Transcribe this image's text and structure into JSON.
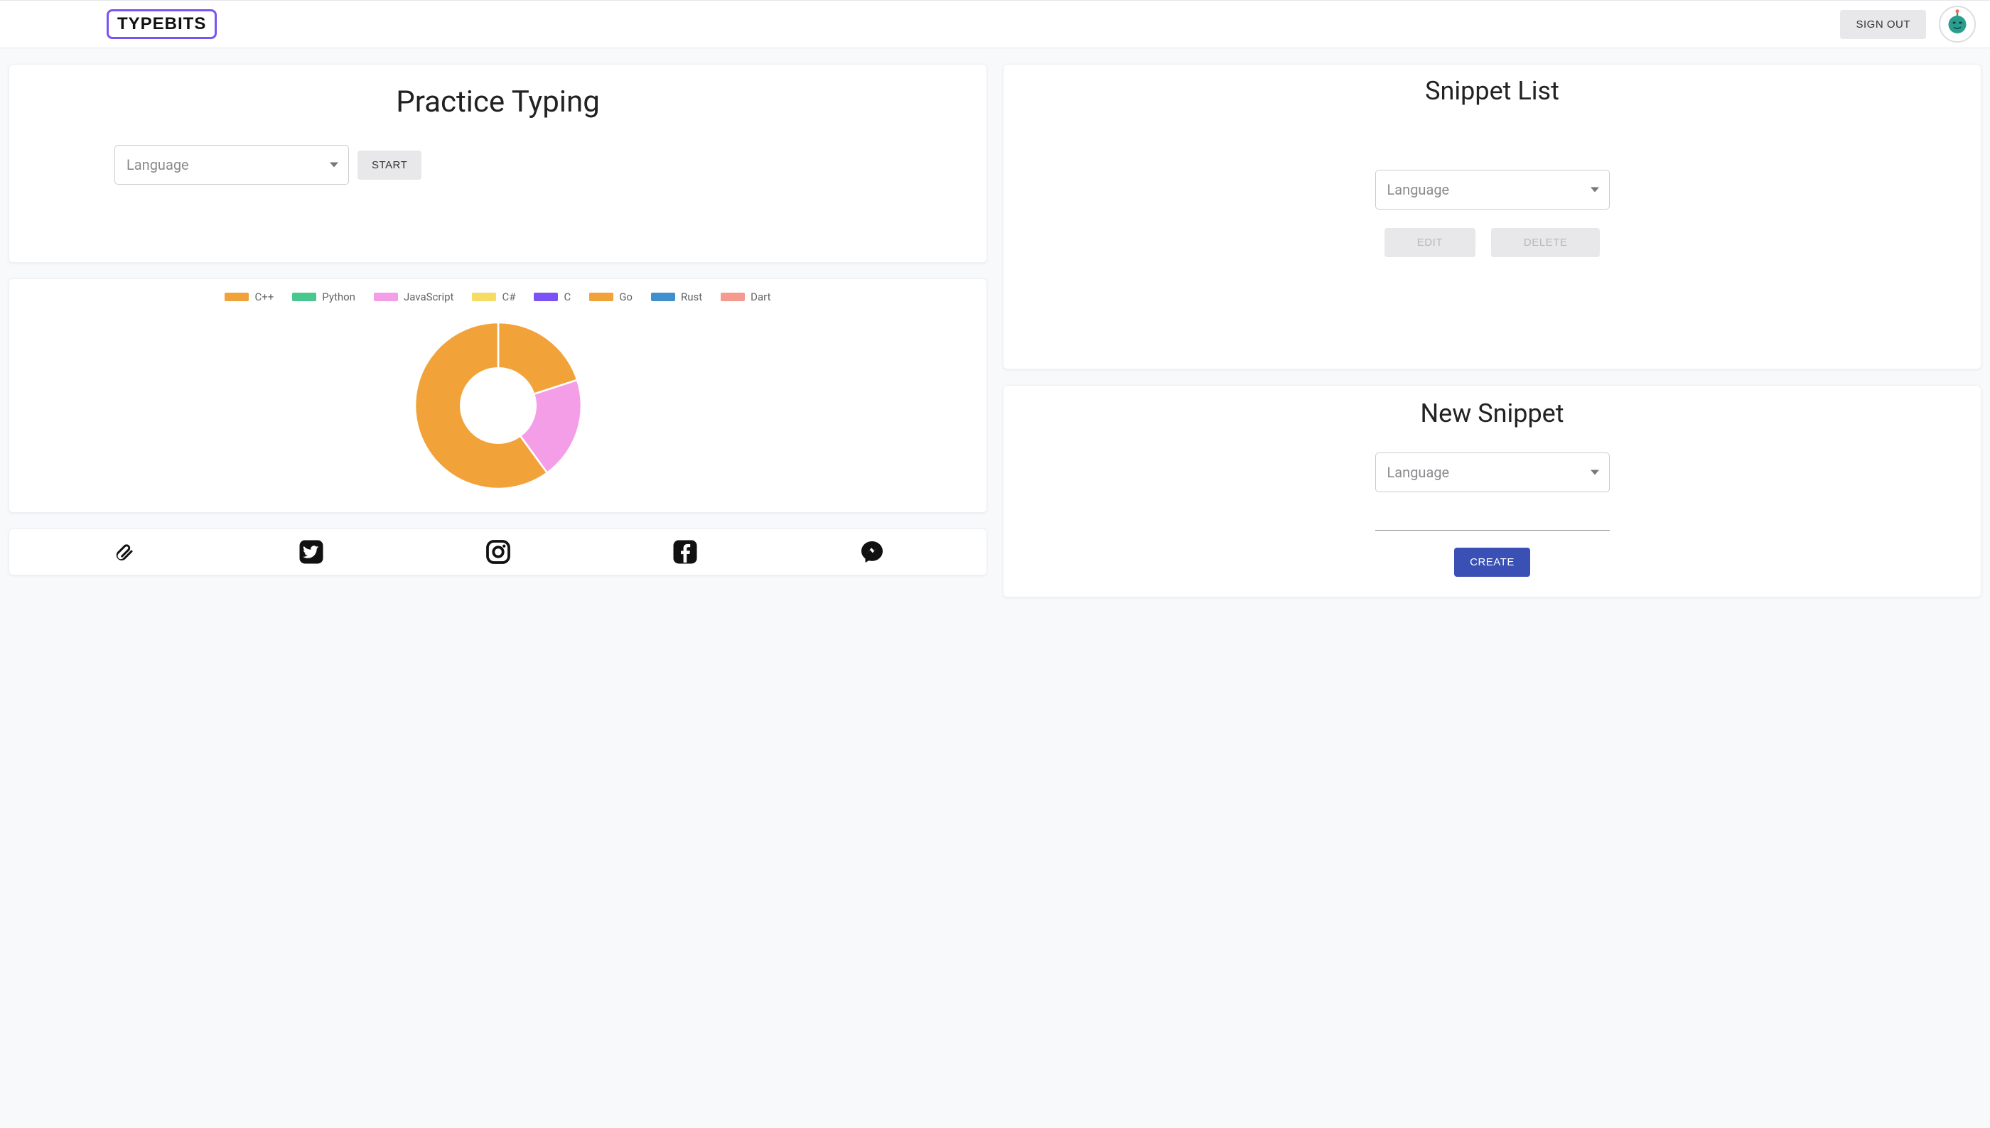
{
  "header": {
    "logo_text": "TYPEBITS",
    "signout_label": "SIGN OUT"
  },
  "practice": {
    "title": "Practice Typing",
    "language_placeholder": "Language",
    "start_label": "START"
  },
  "snippet_list": {
    "title": "Snippet List",
    "language_placeholder": "Language",
    "edit_label": "EDIT",
    "delete_label": "DELETE"
  },
  "new_snippet": {
    "title": "New Snippet",
    "language_placeholder": "Language",
    "create_label": "CREATE"
  },
  "chart_data": {
    "type": "pie",
    "title": "",
    "series": [
      {
        "name": "C++",
        "value": 20,
        "color": "#f1a33a"
      },
      {
        "name": "Python",
        "value": 0,
        "color": "#48c78e"
      },
      {
        "name": "JavaScript",
        "value": 20,
        "color": "#f59ee8"
      },
      {
        "name": "C#",
        "value": 0,
        "color": "#f4dd62"
      },
      {
        "name": "C",
        "value": 0,
        "color": "#7b52f4"
      },
      {
        "name": "Go",
        "value": 60,
        "color": "#f1a33a"
      },
      {
        "name": "Rust",
        "value": 0,
        "color": "#3f8fcf"
      },
      {
        "name": "Dart",
        "value": 0,
        "color": "#f59a8f"
      }
    ],
    "donut_inner_ratio": 0.45
  }
}
